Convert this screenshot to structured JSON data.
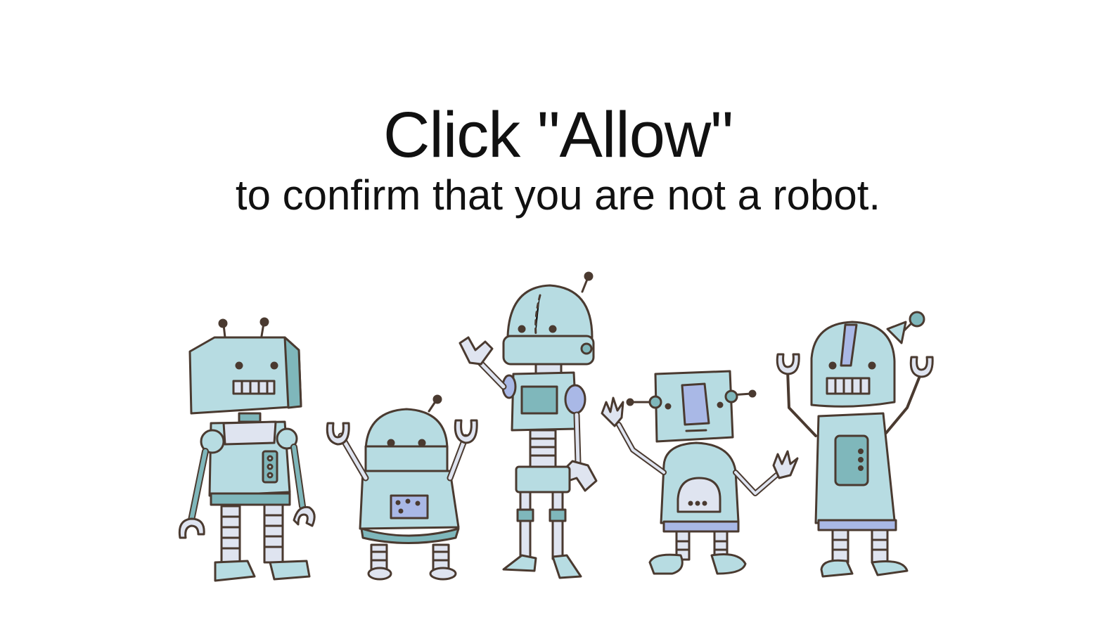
{
  "prompt": {
    "headline": "Click \"Allow\"",
    "message": "to confirm that you are not a robot."
  },
  "illustration": {
    "name": "robots-illustration",
    "colors": {
      "body": "#b7dce2",
      "outline": "#4a3a30",
      "accent": "#7fb7bb",
      "panel": "#a9b8e6",
      "belly": "#dfe4f0"
    }
  }
}
